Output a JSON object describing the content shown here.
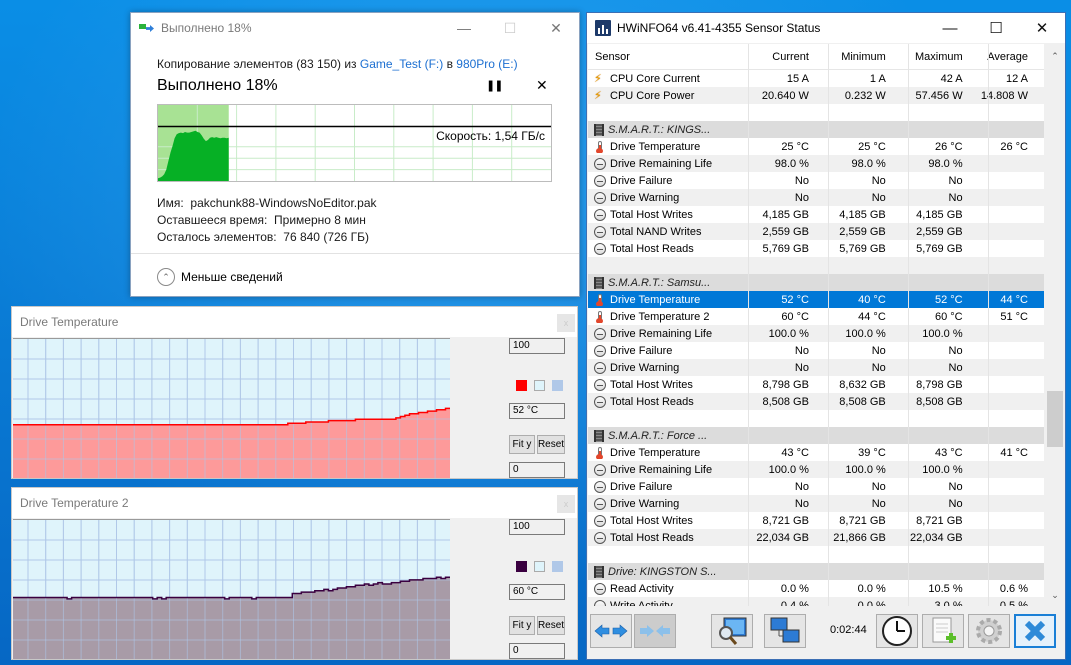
{
  "copy_dialog": {
    "window_title": "Выполнено 18%",
    "desc_prefix": "Копирование элементов (83 150) из ",
    "source": "Game_Test (F:)",
    "desc_mid": " в ",
    "destination": "980Pro (E:)",
    "progress_text": "Выполнено 18%",
    "progress_percent": 18,
    "speed_label": "Скорость: 1,54 ГБ/с",
    "info": {
      "name_label": "Имя:",
      "name_value": "pakchunk88-WindowsNoEditor.pak",
      "time_label": "Оставшееся время:",
      "time_value": "Примерно 8 мин",
      "items_label": "Осталось элементов:",
      "items_value": "76 840 (726 ГБ)"
    },
    "less_details": "Меньше сведений",
    "colors": {
      "done_bg": "#a8e294",
      "throughput": "#06b025",
      "link": "#1c6fd1"
    },
    "speed_history": [
      0.05,
      0.06,
      0.08,
      0.12,
      0.2,
      0.35,
      0.5,
      0.62,
      0.75,
      0.82,
      0.84,
      0.85,
      0.84,
      0.86,
      0.85,
      0.85,
      0.86,
      0.87,
      0.88,
      0.86,
      0.85,
      0.8,
      0.74,
      0.7,
      0.72,
      0.76,
      0.77,
      0.76,
      0.77,
      0.76,
      0.75,
      0.76,
      0.76,
      0.75,
      0.76
    ],
    "current_speed_fraction": 0.78
  },
  "graph1": {
    "title": "Drive Temperature",
    "max_label": "100",
    "min_label": "0",
    "current_label": "52 °C",
    "fit_label": "Fit y",
    "reset_label": "Reset",
    "line_color": "#ff0000",
    "fill_color": "#ff9191",
    "bg_color": "#dff4fb",
    "grid_color": "#b0c8e8",
    "ymax": 100,
    "values": [
      40,
      40,
      40,
      40,
      40,
      40,
      40,
      40,
      40,
      40,
      40,
      40,
      40,
      40,
      40,
      40,
      40,
      40,
      40,
      40,
      40,
      40,
      40,
      40,
      40,
      40,
      40,
      40,
      40,
      40,
      40,
      40,
      40,
      40,
      40,
      40,
      40,
      40,
      40,
      40,
      40,
      40,
      40,
      40,
      40,
      40,
      40,
      40,
      40,
      40,
      40,
      40,
      40,
      40,
      40,
      40,
      40,
      40,
      40,
      40,
      40,
      41,
      41,
      41,
      41,
      42,
      42,
      42,
      42,
      42,
      43,
      43,
      43,
      43,
      43,
      43,
      44,
      44,
      44,
      44,
      44,
      44,
      44,
      44,
      44,
      45,
      46,
      47,
      48,
      48,
      49,
      49,
      50,
      50,
      51,
      51,
      52,
      52
    ]
  },
  "graph2": {
    "title": "Drive Temperature 2",
    "max_label": "100",
    "min_label": "0",
    "current_label": "60 °C",
    "fit_label": "Fit y",
    "reset_label": "Reset",
    "line_color": "#3a0040",
    "fill_color": "#a3939f",
    "bg_color": "#dff4fb",
    "grid_color": "#b0c8e8",
    "ymax": 100,
    "values": [
      46,
      46,
      46,
      46,
      46,
      46,
      46,
      46,
      46,
      46,
      46,
      46,
      45,
      46,
      46,
      46,
      46,
      46,
      46,
      46,
      46,
      46,
      46,
      46,
      46,
      46,
      46,
      46,
      46,
      46,
      46,
      45,
      46,
      45,
      46,
      46,
      46,
      46,
      46,
      46,
      46,
      46,
      46,
      46,
      46,
      46,
      46,
      45,
      46,
      46,
      46,
      46,
      46,
      45,
      46,
      46,
      46,
      46,
      46,
      46,
      46,
      46,
      49,
      49,
      50,
      50,
      50,
      51,
      51,
      52,
      51,
      52,
      53,
      53,
      54,
      54,
      55,
      55,
      56,
      55,
      56,
      57,
      56,
      56,
      57,
      57,
      58,
      58,
      59,
      59,
      59,
      60,
      60,
      60,
      61,
      60,
      61,
      61
    ]
  },
  "hwinfo": {
    "window_title": "HWiNFO64 v6.41-4355 Sensor Status",
    "columns": [
      "Sensor",
      "Current",
      "Minimum",
      "Maximum",
      "Average"
    ],
    "rows": [
      {
        "type": "sensor",
        "icon": "bolt",
        "name": "CPU Core Current",
        "cur": "15 A",
        "min": "1 A",
        "max": "42 A",
        "avg": "12 A"
      },
      {
        "type": "sensor",
        "icon": "bolt",
        "name": "CPU Core Power",
        "cur": "20.640 W",
        "min": "0.232 W",
        "max": "57.456 W",
        "avg": "14.808 W"
      },
      {
        "type": "blank"
      },
      {
        "type": "group",
        "name": "S.M.A.R.T.: KINGS..."
      },
      {
        "type": "sensor",
        "icon": "therm",
        "name": "Drive Temperature",
        "cur": "25 °C",
        "min": "25 °C",
        "max": "26 °C",
        "avg": "26 °C"
      },
      {
        "type": "sensor",
        "icon": "clock",
        "name": "Drive Remaining Life",
        "cur": "98.0 %",
        "min": "98.0 %",
        "max": "98.0 %",
        "avg": ""
      },
      {
        "type": "sensor",
        "icon": "clock",
        "name": "Drive Failure",
        "cur": "No",
        "min": "No",
        "max": "No",
        "avg": ""
      },
      {
        "type": "sensor",
        "icon": "clock",
        "name": "Drive Warning",
        "cur": "No",
        "min": "No",
        "max": "No",
        "avg": ""
      },
      {
        "type": "sensor",
        "icon": "clock",
        "name": "Total Host Writes",
        "cur": "4,185 GB",
        "min": "4,185 GB",
        "max": "4,185 GB",
        "avg": ""
      },
      {
        "type": "sensor",
        "icon": "clock",
        "name": "Total NAND Writes",
        "cur": "2,559 GB",
        "min": "2,559 GB",
        "max": "2,559 GB",
        "avg": ""
      },
      {
        "type": "sensor",
        "icon": "clock",
        "name": "Total Host Reads",
        "cur": "5,769 GB",
        "min": "5,769 GB",
        "max": "5,769 GB",
        "avg": ""
      },
      {
        "type": "blank"
      },
      {
        "type": "group",
        "name": "S.M.A.R.T.: Samsu..."
      },
      {
        "type": "sensor",
        "icon": "therm",
        "name": "Drive Temperature",
        "cur": "52 °C",
        "min": "40 °C",
        "max": "52 °C",
        "avg": "44 °C",
        "selected": true
      },
      {
        "type": "sensor",
        "icon": "therm",
        "name": "Drive Temperature 2",
        "cur": "60 °C",
        "min": "44 °C",
        "max": "60 °C",
        "avg": "51 °C"
      },
      {
        "type": "sensor",
        "icon": "clock",
        "name": "Drive Remaining Life",
        "cur": "100.0 %",
        "min": "100.0 %",
        "max": "100.0 %",
        "avg": ""
      },
      {
        "type": "sensor",
        "icon": "clock",
        "name": "Drive Failure",
        "cur": "No",
        "min": "No",
        "max": "No",
        "avg": ""
      },
      {
        "type": "sensor",
        "icon": "clock",
        "name": "Drive Warning",
        "cur": "No",
        "min": "No",
        "max": "No",
        "avg": ""
      },
      {
        "type": "sensor",
        "icon": "clock",
        "name": "Total Host Writes",
        "cur": "8,798 GB",
        "min": "8,632 GB",
        "max": "8,798 GB",
        "avg": ""
      },
      {
        "type": "sensor",
        "icon": "clock",
        "name": "Total Host Reads",
        "cur": "8,508 GB",
        "min": "8,508 GB",
        "max": "8,508 GB",
        "avg": ""
      },
      {
        "type": "blank"
      },
      {
        "type": "group",
        "name": "S.M.A.R.T.: Force ..."
      },
      {
        "type": "sensor",
        "icon": "therm",
        "name": "Drive Temperature",
        "cur": "43 °C",
        "min": "39 °C",
        "max": "43 °C",
        "avg": "41 °C"
      },
      {
        "type": "sensor",
        "icon": "clock",
        "name": "Drive Remaining Life",
        "cur": "100.0 %",
        "min": "100.0 %",
        "max": "100.0 %",
        "avg": ""
      },
      {
        "type": "sensor",
        "icon": "clock",
        "name": "Drive Failure",
        "cur": "No",
        "min": "No",
        "max": "No",
        "avg": ""
      },
      {
        "type": "sensor",
        "icon": "clock",
        "name": "Drive Warning",
        "cur": "No",
        "min": "No",
        "max": "No",
        "avg": ""
      },
      {
        "type": "sensor",
        "icon": "clock",
        "name": "Total Host Writes",
        "cur": "8,721 GB",
        "min": "8,721 GB",
        "max": "8,721 GB",
        "avg": ""
      },
      {
        "type": "sensor",
        "icon": "clock",
        "name": "Total Host Reads",
        "cur": "22,034 GB",
        "min": "21,866 GB",
        "max": "22,034 GB",
        "avg": ""
      },
      {
        "type": "blank"
      },
      {
        "type": "group",
        "name": "Drive: KINGSTON S..."
      },
      {
        "type": "sensor",
        "icon": "clock",
        "name": "Read Activity",
        "cur": "0.0 %",
        "min": "0.0 %",
        "max": "10.5 %",
        "avg": "0.6 %"
      },
      {
        "type": "sensor",
        "icon": "clock",
        "name": "Write Activity",
        "cur": "0.4 %",
        "min": "0.0 %",
        "max": "3.0 %",
        "avg": "0.5 %"
      }
    ],
    "timer": "0:02:44",
    "toolbar": {
      "expand": "expand-columns",
      "collapse": "collapse-columns",
      "report": "sensor-report",
      "network": "network-monitoring",
      "clock": "reset-timer",
      "logging": "start-logging",
      "settings": "settings",
      "exit": "close-sensors"
    }
  }
}
